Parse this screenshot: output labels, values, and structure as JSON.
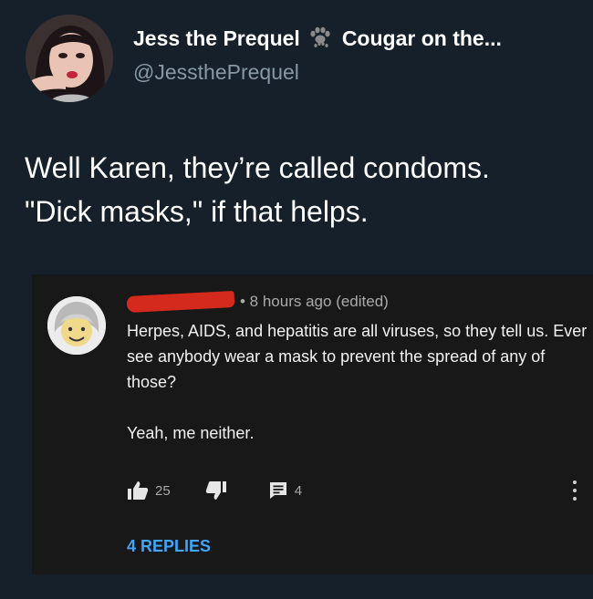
{
  "tweet": {
    "display_name": "Jess the Prequel",
    "name_suffix": "Cougar on the...",
    "handle": "@JesstheP­requel",
    "text_line_1": "Well Karen, they’re called condoms.",
    "text_line_2": "\"Dick masks,\" if that helps."
  },
  "comment": {
    "timestamp": "• 8 hours ago (edited)",
    "paragraph_1": "Herpes, AIDS, and hepatitis are all viruses, so they tell us. Ever see anybody wear a mask to prevent the spread of any of those?",
    "paragraph_2": "Yeah, me neither.",
    "like_count": "25",
    "reply_count": "4",
    "replies_link": "4 REPLIES"
  },
  "icons": {
    "paw": "paw-icon",
    "like": "thumbs-up-icon",
    "dislike": "thumbs-down-icon",
    "reply": "comment-icon",
    "more": "more-vertical-icon"
  },
  "colors": {
    "twitter_bg": "#15202b",
    "comment_bg": "#181818",
    "link_blue": "#3ea6ff",
    "muted": "#8899a6",
    "redaction": "#d4291d"
  }
}
